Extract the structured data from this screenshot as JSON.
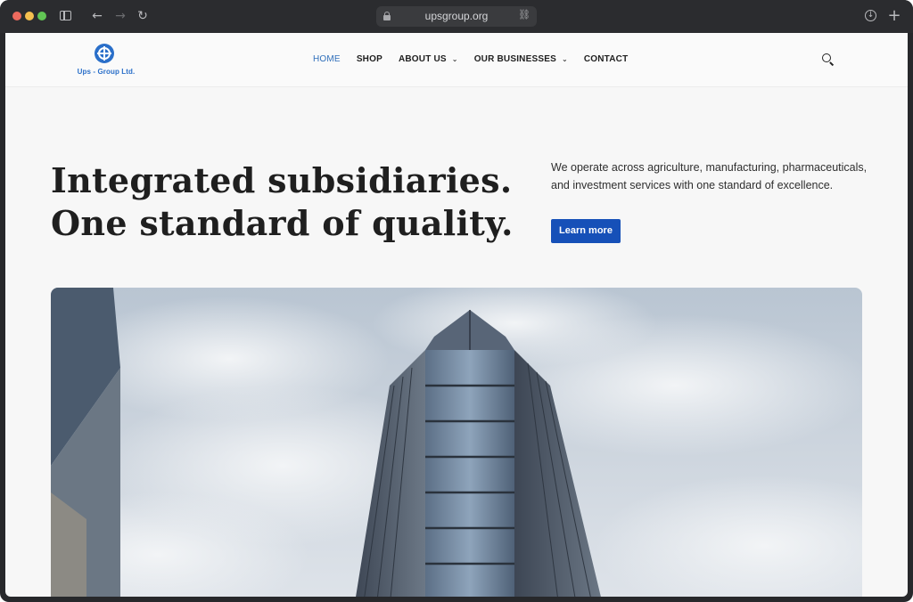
{
  "browser": {
    "url": "upsgroup.org"
  },
  "site": {
    "logo_text": "Ups - Group Ltd.",
    "nav": [
      {
        "label": "HOME",
        "active": true
      },
      {
        "label": "SHOP"
      },
      {
        "label": "ABOUT US",
        "has_dropdown": true
      },
      {
        "label": "OUR BUSINESSES",
        "has_dropdown": true
      },
      {
        "label": "CONTACT"
      }
    ]
  },
  "hero": {
    "heading_line1": "Integrated subsidiaries.",
    "heading_line2": "One standard of quality.",
    "description": "We operate across agriculture, manufacturing, pharmaceuticals, and investment services with one standard of excellence.",
    "cta_label": "Learn more",
    "image": "glass office tower against cloudy sky"
  },
  "colors": {
    "accent": "#1650b8",
    "nav_active": "#2f6fba",
    "logo": "#2a6fc9"
  }
}
